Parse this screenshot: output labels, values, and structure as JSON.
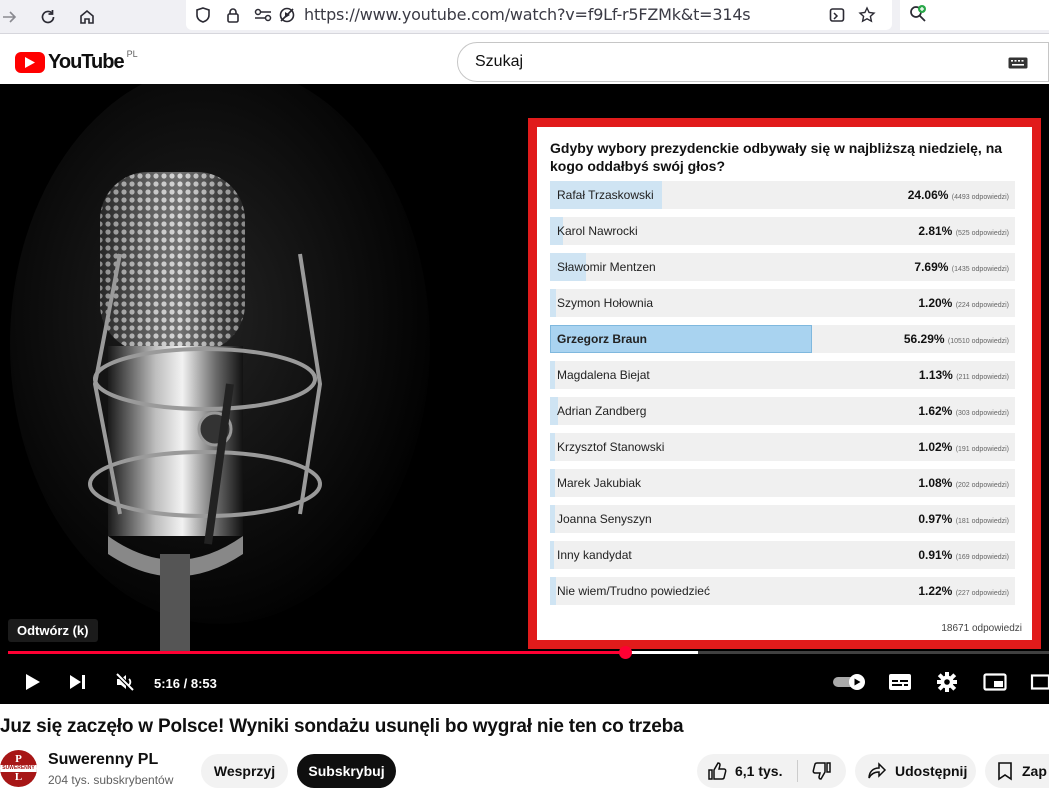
{
  "browser": {
    "url": "https://www.youtube.com/watch?v=f9Lf-r5FZMk&t=314s"
  },
  "header": {
    "logo_text": "YouTube",
    "country_code": "PL",
    "search_placeholder": "Szukaj"
  },
  "poll": {
    "question": "Gdyby wybory prezydenckie odbywały się w najbliższą niedzielę, na kogo oddałbyś swój głos?",
    "options": [
      {
        "name": "Rafał Trzaskowski",
        "percent": "24.06%",
        "votes": "(4493 odpowiedzi)",
        "share": 24.06
      },
      {
        "name": "Karol Nawrocki",
        "percent": "2.81%",
        "votes": "(525 odpowiedzi)",
        "share": 2.81
      },
      {
        "name": "Sławomir Mentzen",
        "percent": "7.69%",
        "votes": "(1435 odpowiedzi)",
        "share": 7.69
      },
      {
        "name": "Szymon Hołownia",
        "percent": "1.20%",
        "votes": "(224 odpowiedzi)",
        "share": 1.2
      },
      {
        "name": "Grzegorz Braun",
        "percent": "56.29%",
        "votes": "(10510 odpowiedzi)",
        "share": 56.29
      },
      {
        "name": "Magdalena Biejat",
        "percent": "1.13%",
        "votes": "(211 odpowiedzi)",
        "share": 1.13
      },
      {
        "name": "Adrian Zandberg",
        "percent": "1.62%",
        "votes": "(303 odpowiedzi)",
        "share": 1.62
      },
      {
        "name": "Krzysztof Stanowski",
        "percent": "1.02%",
        "votes": "(191 odpowiedzi)",
        "share": 1.02
      },
      {
        "name": "Marek Jakubiak",
        "percent": "1.08%",
        "votes": "(202 odpowiedzi)",
        "share": 1.08
      },
      {
        "name": "Joanna Senyszyn",
        "percent": "0.97%",
        "votes": "(181 odpowiedzi)",
        "share": 0.97
      },
      {
        "name": "Inny kandydat",
        "percent": "0.91%",
        "votes": "(169 odpowiedzi)",
        "share": 0.91
      },
      {
        "name": "Nie wiem/Trudno powiedzieć",
        "percent": "1.22%",
        "votes": "(227 odpowiedzi)",
        "share": 1.22
      }
    ],
    "total": "18671 odpowiedzi",
    "highlight_index": 4,
    "border_color": "#e11b1b",
    "fill_color": "#cfe4f3",
    "highlight_fill_color": "#a9d3f0"
  },
  "player": {
    "tooltip": "Odtwórz (k)",
    "time": "5:16 / 8:53",
    "played_fraction": 0.593,
    "loaded_fraction": 0.663,
    "progress_color": "#ff0033"
  },
  "video": {
    "title": "Juz się zaczęło w Polsce! Wyniki sondażu usunęli bo wygrał nie ten co trzeba"
  },
  "channel": {
    "name": "Suwerenny PL",
    "subscribers": "204 tys. subskrybentów",
    "avatar_text_top": "P",
    "avatar_text_mid": "SUWERENNY",
    "avatar_text_bottom": "L"
  },
  "actions": {
    "support_label": "Wesprzyj",
    "subscribe_label": "Subskrybuj",
    "likes": "6,1 tys.",
    "share_label": "Udostępnij",
    "save_label": "Zap"
  }
}
